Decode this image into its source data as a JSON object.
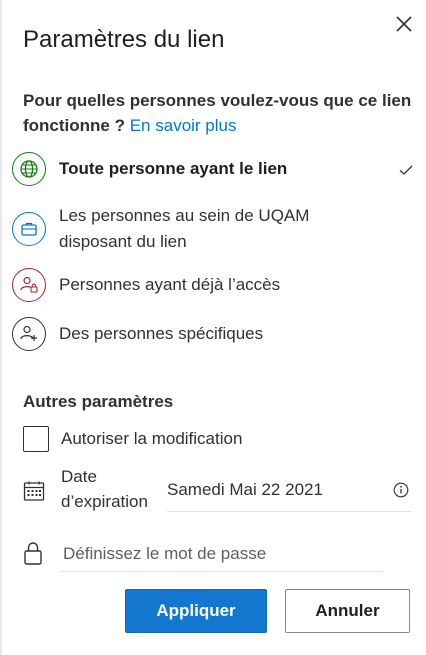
{
  "panel": {
    "title": "Paramètres du lien",
    "close_icon": "close-icon"
  },
  "audience": {
    "question": "Pour quelles personnes voulez-vous que ce lien fonctionne ?",
    "learn_more": "En savoir plus",
    "options": [
      {
        "label": "Toute personne ayant le lien",
        "icon": "globe-icon",
        "selected": true,
        "icon_color": "#107c10"
      },
      {
        "label": "Les personnes au sein de UQAM disposant du lien",
        "icon": "briefcase-icon",
        "selected": false,
        "icon_color": "#0078d4"
      },
      {
        "label": "Personnes ayant déjà l’accès",
        "icon": "people-lock-icon",
        "selected": false,
        "icon_color": "#a4262c"
      },
      {
        "label": "Des personnes spécifiques",
        "icon": "people-add-icon",
        "selected": false,
        "icon_color": "#323130"
      }
    ]
  },
  "other_settings": {
    "heading": "Autres paramètres",
    "allow_edit_label": "Autoriser la modification",
    "allow_edit_checked": false,
    "expiration_label": "Date d’expiration",
    "expiration_value": "Samedi Mai 22 2021",
    "password_placeholder": "Définissez le mot de passe"
  },
  "actions": {
    "apply": "Appliquer",
    "cancel": "Annuler"
  },
  "colors": {
    "accent": "#0078d4",
    "primary_button": "#1377cf"
  }
}
